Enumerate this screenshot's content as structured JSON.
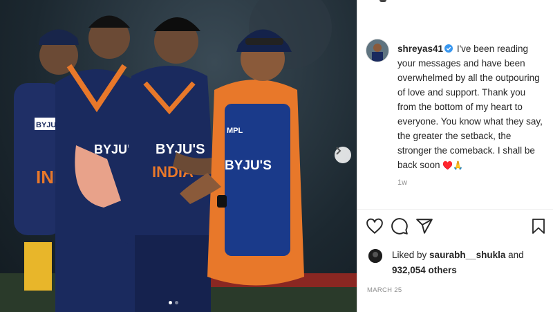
{
  "post": {
    "username": "shreyas41",
    "caption": "I've been reading your messages and have been overwhelmed by all the outpouring of love and support. Thank you from the bottom of my heart to everyone. You know what they say, the greater the setback, the stronger the comeback. I shall be back soon",
    "caption_emoji": "♥️🙏",
    "time_ago": "1w",
    "date": "MARCH 25"
  },
  "likes": {
    "prefix": "Liked by ",
    "liker": "saurabh__shukla",
    "and": " and",
    "others": "932,054 others"
  },
  "photo": {
    "jersey_text_1": "BYJU'S",
    "jersey_text_2": "INDIA",
    "jersey_text_3": "BYJU'S",
    "jersey_text_4": "MPL",
    "jersey_text_5": "INI"
  },
  "colors": {
    "verified": "#3897f0",
    "jersey_navy": "#1a2a5e",
    "jersey_orange": "#e8782a"
  },
  "icons": [
    "chevron-right-icon",
    "heart-icon",
    "comment-icon",
    "share-icon",
    "bookmark-icon",
    "verified-icon"
  ]
}
